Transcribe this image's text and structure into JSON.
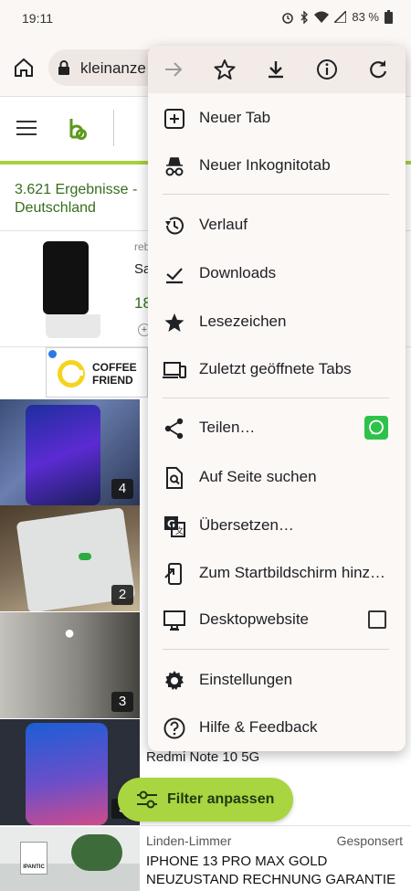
{
  "statusbar": {
    "time": "19:11",
    "battery": "83 %"
  },
  "browser": {
    "url": "kleinanze"
  },
  "page": {
    "results_text": "3.621 Ergebnisse - Deutschland",
    "listing1": {
      "small": "reb",
      "title": "Sa",
      "price": "18",
      "plus": "+"
    },
    "ad": {
      "brand_line1": "COFFEE",
      "brand_line2": "FRIEND"
    },
    "thumbs": [
      {
        "count": "4"
      },
      {
        "count": "2"
      },
      {
        "count": "3"
      },
      {
        "count": "3"
      }
    ],
    "listing_redmi": {
      "title": "Redmi Note 10 5G"
    },
    "listing5": {
      "location": "Linden-Limmer",
      "sponsored": "Gesponsert",
      "title": "IPHONE 13 PRO MAX GOLD NEUZUSTAND RECHNUNG GARANTIE"
    },
    "thumb5_logo": "IPANTIC",
    "filter_button": "Filter anpassen"
  },
  "menu": {
    "items": [
      {
        "label": "Neuer Tab",
        "icon": "new-tab-icon"
      },
      {
        "label": "Neuer Inkognitotab",
        "icon": "incognito-icon"
      },
      {
        "label": "Verlauf",
        "icon": "history-icon"
      },
      {
        "label": "Downloads",
        "icon": "downloads-icon"
      },
      {
        "label": "Lesezeichen",
        "icon": "star-icon"
      },
      {
        "label": "Zuletzt geöffnete Tabs",
        "icon": "recent-tabs-icon"
      },
      {
        "label": "Teilen…",
        "icon": "share-icon"
      },
      {
        "label": "Auf Seite suchen",
        "icon": "find-in-page-icon"
      },
      {
        "label": "Übersetzen…",
        "icon": "translate-icon"
      },
      {
        "label": "Zum Startbildschirm hinz…",
        "icon": "add-to-home-icon"
      },
      {
        "label": "Desktopwebsite",
        "icon": "desktop-icon"
      },
      {
        "label": "Einstellungen",
        "icon": "settings-icon"
      },
      {
        "label": "Hilfe & Feedback",
        "icon": "help-icon"
      }
    ]
  }
}
